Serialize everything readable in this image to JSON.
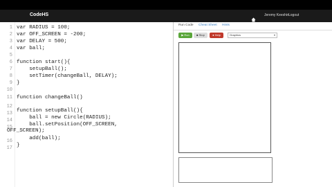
{
  "header": {
    "logo": "CodeHS",
    "user": "Jeremy Keeshin",
    "logout": "Logout"
  },
  "editor": {
    "line_numbers": [
      "1",
      "2",
      "3",
      "4",
      "5",
      "6",
      "7",
      "8",
      "9",
      "10",
      "11",
      "12",
      "13",
      "14",
      "15",
      "16",
      "17"
    ],
    "lines": [
      "var RADIUS = 100;",
      "var OFF_SCREEN = -200;",
      "var DELAY = 500;",
      "var ball;",
      "",
      "function start(){",
      "    setupBall();",
      "    setTimer(changeBall, DELAY);",
      "}",
      "",
      "function changeBall()",
      "",
      "function setupBall(){",
      "    ball = new Circle(RADIUS);",
      "    ball.setPosition(OFF_SCREEN,",
      "OFF_SCREEN);",
      "    add(ball);",
      "}"
    ]
  },
  "right_panel": {
    "tabs": [
      "Run Code",
      "Cheat Sheet",
      "Hints"
    ],
    "buttons": {
      "run": "▶ Run",
      "stop": "■ Stop",
      "help": "● Help"
    },
    "select_value": "Graphics"
  }
}
